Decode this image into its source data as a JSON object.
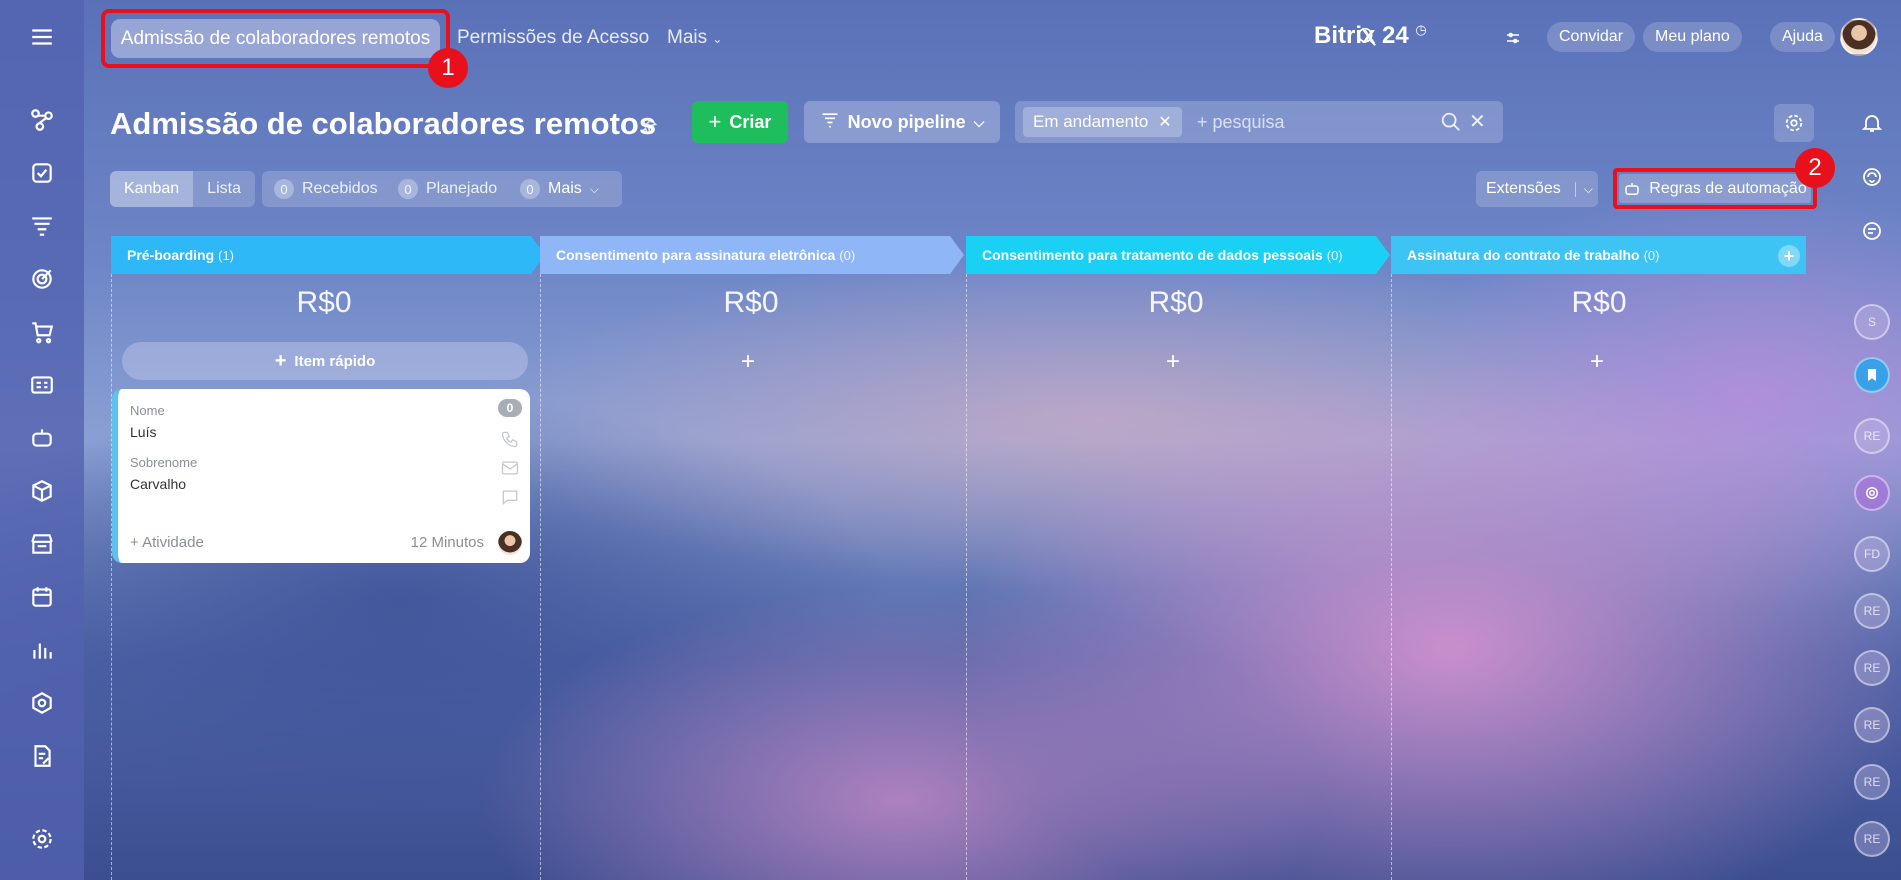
{
  "top_nav": {
    "active_tab": "Admissão de colaboradores remotos",
    "tab_access": "Permissões de Acesso",
    "tab_more": "Mais",
    "logo_text": "Bitrix 24",
    "invite": "Convidar",
    "my_plan": "Meu plano",
    "help": "Ajuda",
    "annotation_1": "1",
    "annotation_2": "2"
  },
  "page": {
    "title": "Admissão de colaboradores remotos",
    "create_label": "Criar",
    "pipeline_label": "Novo pipeline",
    "filter_chip": "Em andamento",
    "search_placeholder": "+ pesquisa"
  },
  "toolbar": {
    "view_kanban": "Kanban",
    "view_list": "Lista",
    "received_count": "0",
    "received_label": "Recebidos",
    "planned_count": "0",
    "planned_label": "Planejado",
    "more_count": "0",
    "more_label": "Mais",
    "extensions": "Extensões",
    "automation_rules": "Regras de automação"
  },
  "stages": [
    {
      "name": "Pré-boarding",
      "count": "(1)",
      "amount": "R$0",
      "color": "#2fb8f8"
    },
    {
      "name": "Consentimento para assinatura eletrônica",
      "count": "(0)",
      "amount": "R$0",
      "color": "#8fb6f7"
    },
    {
      "name": "Consentimento para tratamento de dados pessoais",
      "count": "(0)",
      "amount": "R$0",
      "color": "#1ad0f5"
    },
    {
      "name": "Assinatura do contrato de trabalho",
      "count": "(0)",
      "amount": "R$0",
      "color": "#3ec3f5"
    }
  ],
  "quick_item": "Item rápido",
  "deal_card": {
    "badge": "0",
    "field1_label": "Nome",
    "field1_value": "Luís",
    "field2_label": "Sobrenome",
    "field2_value": "Carvalho",
    "activity": "+ Atividade",
    "time": "12 Minutos"
  },
  "right_bar": {
    "avatars": [
      "S",
      "RE",
      "FD",
      "RE",
      "RE",
      "RE",
      "RE",
      "RE"
    ]
  },
  "colors": {
    "accent_green": "#1fbe5c",
    "annotation_red": "#e8101a"
  }
}
